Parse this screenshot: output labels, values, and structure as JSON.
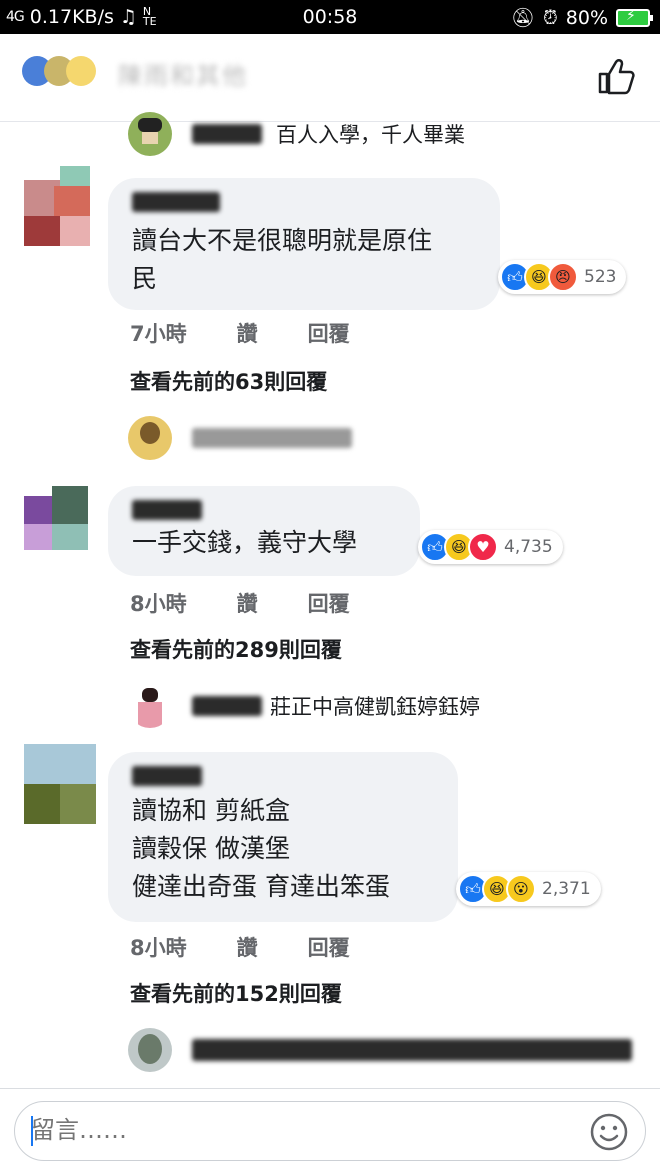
{
  "status_bar": {
    "signal": "4G",
    "speed": "0.17KB/s",
    "time": "00:58",
    "battery": "80%"
  },
  "header": {
    "title_blurred": "陳雨和其他 "
  },
  "top_reply": {
    "text": "百人入學，千人畢業"
  },
  "comments": [
    {
      "text": "讀台大不是很聰明就是原住\n民",
      "reaction_count": "523",
      "time": "7小時",
      "like": "讚",
      "reply": "回覆",
      "more_replies": "查看先前的63則回覆"
    },
    {
      "text": "一手交錢，義守大學",
      "reaction_count": "4,735",
      "time": "8小時",
      "like": "讚",
      "reply": "回覆",
      "more_replies": "查看先前的289則回覆",
      "reply_preview": "莊正中高健凱鈺婷鈺婷"
    },
    {
      "text": "讀協和 剪紙盒\n讀穀保 做漢堡\n健達出奇蛋 育達出笨蛋",
      "reaction_count": "2,371",
      "time": "8小時",
      "like": "讚",
      "reply": "回覆",
      "more_replies": "查看先前的152則回覆"
    }
  ],
  "composer": {
    "placeholder": "留言……"
  },
  "colors": {
    "like_blue": "#1877f2",
    "bubble_bg": "#f0f2f5",
    "meta_gray": "#65676b"
  }
}
